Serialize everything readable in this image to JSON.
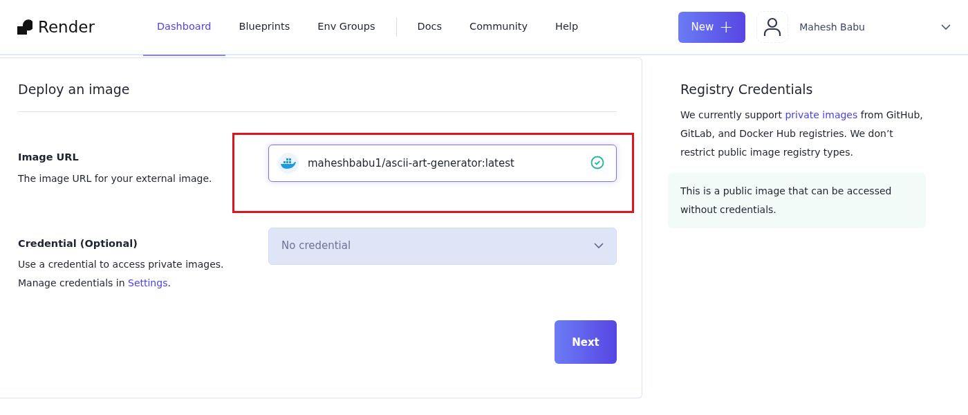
{
  "brand": "Render",
  "nav": [
    {
      "label": "Dashboard",
      "selected": true
    },
    {
      "label": "Blueprints",
      "selected": false
    },
    {
      "label": "Env Groups",
      "selected": false
    },
    {
      "label": "Docs",
      "selected": false,
      "divider_before": true
    },
    {
      "label": "Community",
      "selected": false
    },
    {
      "label": "Help",
      "selected": false
    }
  ],
  "new_button": {
    "label": "New",
    "icon": "+"
  },
  "user": {
    "name": "Mahesh Babu"
  },
  "form": {
    "title": "Deploy an image",
    "fields": [
      {
        "kind": "image",
        "label": "Image URL",
        "help": [
          {
            "text": "The image URL for your external image."
          }
        ],
        "value": "maheshbabu1/ascii-art-generator:latest",
        "valid": true,
        "highlighted": true
      },
      {
        "kind": "select",
        "label": "Credential (Optional)",
        "help": [
          {
            "text": "Use a credential to access private images."
          },
          {
            "text": "Manage credentials in ",
            "link": "Settings",
            "after": "."
          }
        ],
        "placeholder": "No credential",
        "disabled": true
      }
    ],
    "submit": "Next"
  },
  "aside": {
    "title": "Registry Credentials",
    "lines": [
      {
        "text": "We currently support ",
        "link": "private images",
        "after": " from GitHub, GitLab, and Docker Hub registries. We don’t restrict public image registry types."
      }
    ],
    "note": "This is a public image that can be accessed without credentials."
  }
}
